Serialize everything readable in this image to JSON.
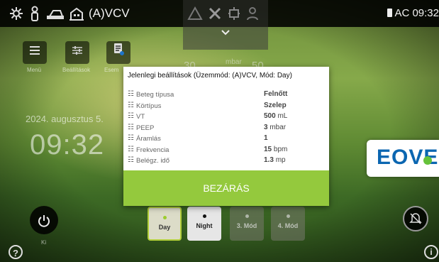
{
  "topbar": {
    "mode_label": "(A)VCV",
    "ac_status": "AC 09:32",
    "icons": [
      "settings-icon",
      "patient-icon",
      "circuit-icon",
      "building-icon"
    ],
    "center_icons": [
      "alarm-triangle-icon",
      "tools-icon",
      "plug-icon",
      "user-icon"
    ]
  },
  "background": {
    "param_unit": "mbar",
    "param_a": "30",
    "param_b": "50"
  },
  "side_menu": [
    {
      "label": "Menü",
      "icon": "menu-icon"
    },
    {
      "label": "Beállítások",
      "icon": "sliders-icon"
    },
    {
      "label": "Esem",
      "icon": "notes-icon"
    }
  ],
  "date": "2024. augusztus 5.",
  "clock": "09:32",
  "logo_text": "EOVE",
  "power_label": "Ki",
  "mode_buttons": [
    {
      "label": "Day",
      "active": true
    },
    {
      "label": "Night",
      "active": false
    },
    {
      "label": "3. Mód",
      "active": false
    },
    {
      "label": "4. Mód",
      "active": false
    }
  ],
  "modal": {
    "title": "Jelenlegi beállítások (Üzemmód: (A)VCV, Mód: Day)",
    "rows": [
      {
        "label": "Beteg típusa",
        "value": "Felnőtt",
        "unit": ""
      },
      {
        "label": "Körtípus",
        "value": "Szelep",
        "unit": ""
      },
      {
        "label": "VT",
        "value": "500",
        "unit": "mL"
      },
      {
        "label": "PEEP",
        "value": "3",
        "unit": "mbar"
      },
      {
        "label": "Áramlás",
        "value": "1",
        "unit": ""
      },
      {
        "label": "Frekvencia",
        "value": "15",
        "unit": "bpm"
      },
      {
        "label": "Belégz. idő",
        "value": "1.3",
        "unit": "mp"
      }
    ],
    "close_label": "BEZÁRÁS"
  },
  "colors": {
    "accent": "#94c93d",
    "brand": "#0b66b1"
  }
}
